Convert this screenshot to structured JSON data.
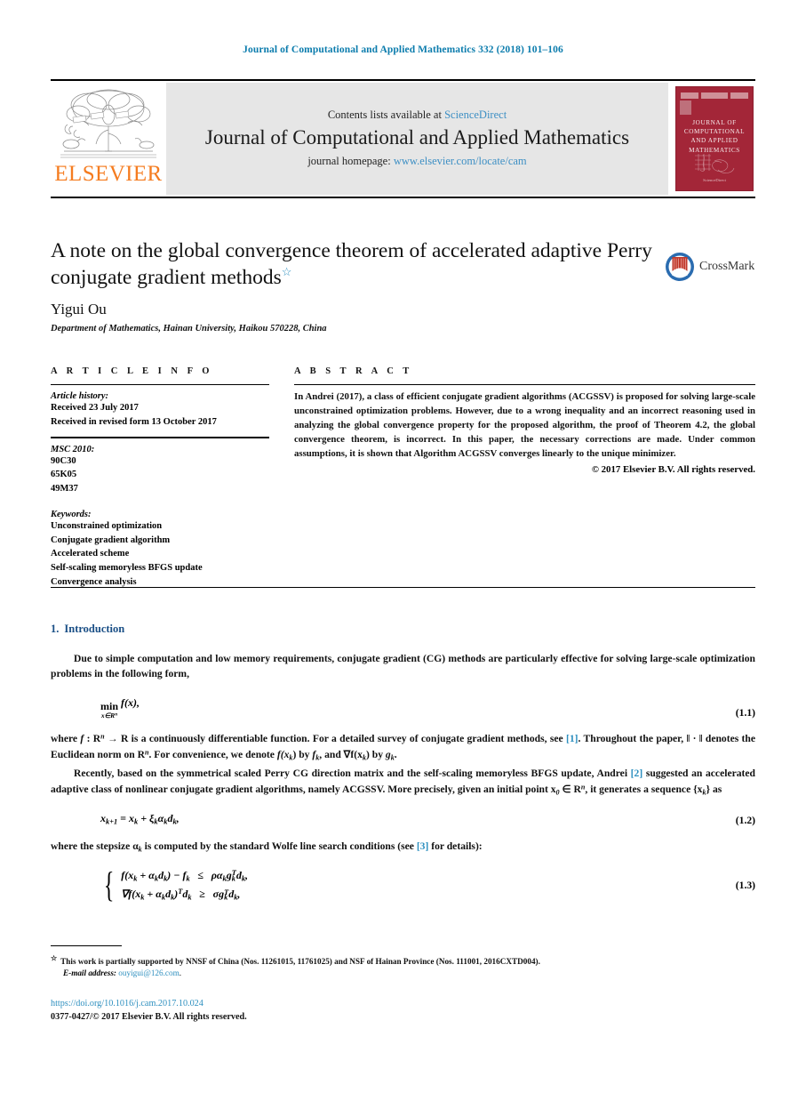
{
  "running_head": "Journal of Computational and Applied Mathematics 332 (2018) 101–106",
  "masthead": {
    "contents_prefix": "Contents lists available at ",
    "contents_link": "ScienceDirect",
    "journal_title": "Journal of Computational and Applied Mathematics",
    "homepage_prefix": "journal homepage: ",
    "homepage_url": "www.elsevier.com/locate/cam",
    "publisher_wordmark": "ELSEVIER",
    "cover_title": "JOURNAL OF COMPUTATIONAL AND APPLIED MATHEMATICS",
    "cover_footer": "ScienceDirect",
    "accent_link_color": "#3d8fc4",
    "publisher_color": "#f57c20",
    "cover_color": "#a32638"
  },
  "article": {
    "title": "A note on the global convergence theorem of accelerated adaptive Perry conjugate gradient methods",
    "title_footnote_marker": "☆",
    "author": "Yigui Ou",
    "affiliation": "Department of Mathematics, Hainan University, Haikou 570228, China",
    "crossmark_label": "CrossMark"
  },
  "article_info": {
    "heading": "A R T I C L E   I N F O",
    "history_label": "Article history:",
    "history": [
      "Received 23 July 2017",
      "Received in revised form 13 October 2017"
    ],
    "msc_label": "MSC 2010:",
    "msc": [
      "90C30",
      "65K05",
      "49M37"
    ],
    "keywords_label": "Keywords:",
    "keywords": [
      "Unconstrained optimization",
      "Conjugate gradient algorithm",
      "Accelerated scheme",
      "Self-scaling memoryless BFGS update",
      "Convergence analysis"
    ]
  },
  "abstract": {
    "heading": "A B S T R A C T",
    "text": "In Andrei (2017), a class of efficient conjugate gradient algorithms (ACGSSV) is proposed for solving large-scale unconstrained optimization problems. However, due to a wrong inequality and an incorrect reasoning used in analyzing the global convergence property for the proposed algorithm, the proof of Theorem 4.2, the global convergence theorem, is incorrect. In this paper, the necessary corrections are made. Under common assumptions, it is shown that Algorithm ACGSSV converges linearly to the unique minimizer.",
    "copyright": "© 2017 Elsevier B.V. All rights reserved."
  },
  "section": {
    "number": "1.",
    "title": "Introduction",
    "para1": "Due to simple computation and low memory requirements, conjugate gradient (CG) methods are particularly effective for solving large-scale optimization problems in the following form,",
    "eq1_num": "(1.1)",
    "eq1_min": "min",
    "eq1_sub": "x∈R",
    "eq1_sub_sup": "n",
    "eq1_fn": "f(x),",
    "para2_a": "where ",
    "para2_f": "f",
    "para2_b": " :  R",
    "para2_c": "  →  R is a continuously differentiable function. For a detailed survey of conjugate gradient methods, see ",
    "cite1": "[1]",
    "para2_d": ". Throughout the paper, ‖ · ‖ denotes the Euclidean norm on R",
    "para2_e": ". For convenience, we denote ",
    "para2_f2": "f(x",
    "para2_g": ") by ",
    "para2_h": ", and ∇f(x",
    "para2_i": ") by ",
    "para2_j": ".",
    "para3_a": "Recently, based on the symmetrical scaled Perry CG direction matrix and the self-scaling memoryless BFGS update, Andrei ",
    "cite2": "[2]",
    "para3_b": " suggested an accelerated adaptive class of nonlinear conjugate gradient algorithms, namely ACGSSV. More precisely, given an initial point x",
    "para3_c": " ∈ R",
    "para3_d": ", it generates a sequence {x",
    "para3_e": "} as",
    "eq2_num": "(1.2)",
    "eq2": "x",
    "eq3_num": "(1.3)",
    "para4_a": "where the stepsize α",
    "para4_b": " is computed by the standard Wolfe line search conditions (see ",
    "cite3": "[3]",
    "para4_c": " for details):"
  },
  "footnote": {
    "marker": "☆",
    "funding": "This work is partially supported by NNSF of China (Nos. 11261015, 11761025) and NSF of Hainan Province (Nos. 111001, 2016CXTD004).",
    "email_label": "E-mail address:",
    "email": "ouyigui@126.com",
    "email_period": ".",
    "doi": "https://doi.org/10.1016/j.cam.2017.10.024",
    "issn": "0377-0427/© 2017 Elsevier B.V. All rights reserved."
  }
}
